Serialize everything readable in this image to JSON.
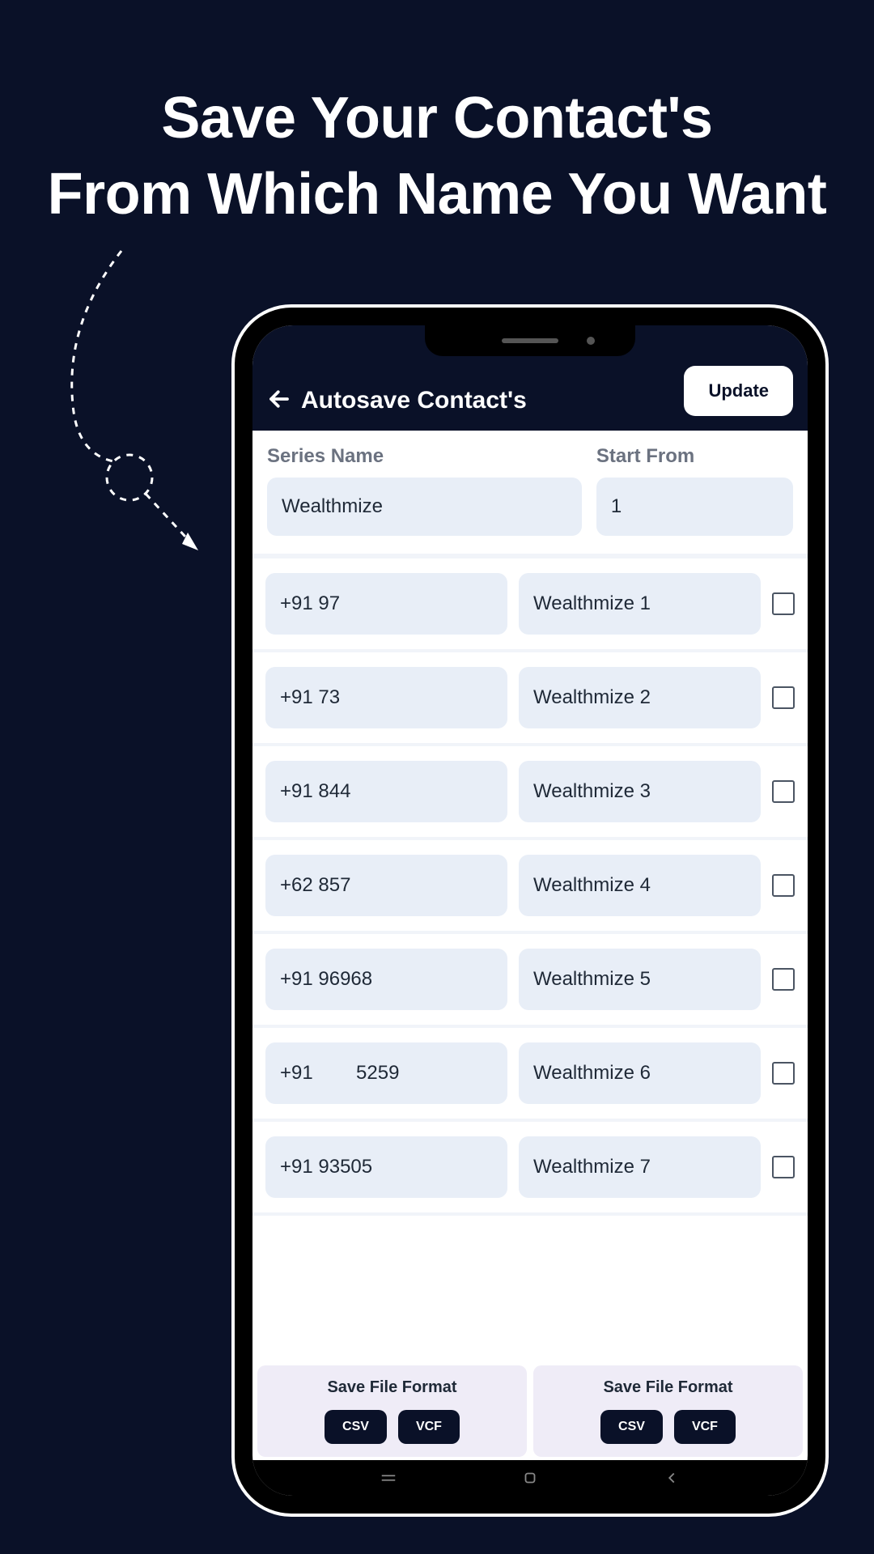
{
  "headline": {
    "line1": "Save Your Contact's",
    "line2": "From Which Name You Want"
  },
  "header": {
    "title": "Autosave Contact's",
    "update_label": "Update"
  },
  "config": {
    "series_label": "Series Name",
    "series_value": "Wealthmize",
    "start_label": "Start From",
    "start_value": "1"
  },
  "contacts": [
    {
      "phone": "+91 97",
      "name": "Wealthmize 1"
    },
    {
      "phone": "+91 73",
      "name": "Wealthmize 2"
    },
    {
      "phone": "+91 844",
      "name": "Wealthmize 3"
    },
    {
      "phone": "+62 857",
      "name": "Wealthmize 4"
    },
    {
      "phone": "+91 96968",
      "name": "Wealthmize 5"
    },
    {
      "phone": "+91        5259",
      "name": "Wealthmize 6"
    },
    {
      "phone": "+91 93505",
      "name": "Wealthmize 7"
    }
  ],
  "footer": {
    "save_label": "Save File Format",
    "csv_label": "CSV",
    "vcf_label": "VCF"
  }
}
